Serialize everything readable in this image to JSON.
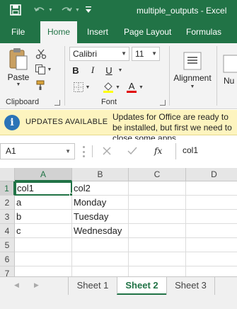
{
  "title_bar": {
    "doc_title": "multiple_outputs  -  Excel",
    "save_icon": "save-icon",
    "undo_icon": "undo-icon",
    "redo_icon": "redo-icon",
    "qat_icon": "customize-quick-access-icon"
  },
  "ribbon_tabs": [
    {
      "label": "File"
    },
    {
      "label": "Home",
      "active": true
    },
    {
      "label": "Insert"
    },
    {
      "label": "Page Layout"
    },
    {
      "label": "Formulas"
    }
  ],
  "ribbon": {
    "clipboard": {
      "label": "Clipboard",
      "paste_label": "Paste"
    },
    "font": {
      "label": "Font",
      "font_name": "Calibri",
      "font_size": "11",
      "bold": "B",
      "italic": "I",
      "underline": "U",
      "font_color": "A",
      "highlight_color": "#ffff00",
      "text_color": "#e00000"
    },
    "alignment": {
      "label": "Alignment"
    },
    "number": {
      "label": "Nu"
    }
  },
  "message_bar": {
    "heading": "UPDATES AVAILABLE",
    "message": "Updates for Office are ready to be installed, but first we need to close some apps."
  },
  "formula_bar": {
    "name_box": "A1",
    "fx_label": "fx",
    "formula": "col1"
  },
  "grid": {
    "columns": [
      "A",
      "B",
      "C",
      "D"
    ],
    "rows": [
      "1",
      "2",
      "3",
      "4",
      "5",
      "6",
      "7"
    ],
    "cells": [
      [
        "col1",
        "col2",
        "",
        ""
      ],
      [
        "a",
        "Monday",
        "",
        ""
      ],
      [
        "b",
        "Tuesday",
        "",
        ""
      ],
      [
        "c",
        "Wednesday",
        "",
        ""
      ],
      [
        "",
        "",
        "",
        ""
      ],
      [
        "",
        "",
        "",
        ""
      ],
      [
        "",
        "",
        "",
        ""
      ]
    ]
  },
  "sheet_tabs": [
    {
      "label": "Sheet 1"
    },
    {
      "label": "Sheet 2",
      "active": true
    },
    {
      "label": "Sheet 3"
    }
  ],
  "colors": {
    "brand": "#217346",
    "message_bg": "#fdf4bf",
    "info_icon": "#2b74b7"
  }
}
